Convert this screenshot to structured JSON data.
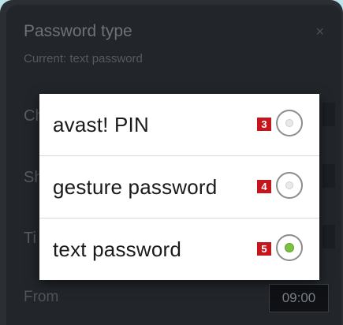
{
  "background_screen": {
    "title": "Password type",
    "subtitle": "Current: text password",
    "close_glyph": "×",
    "row_labels": [
      "Ch",
      "Sh",
      "Ti"
    ],
    "from_label": "From",
    "from_time": "09:00"
  },
  "dialog": {
    "options": [
      {
        "label": "avast! PIN",
        "badge": "3",
        "selected": false
      },
      {
        "label": "gesture password",
        "badge": "4",
        "selected": false
      },
      {
        "label": "text password",
        "badge": "5",
        "selected": true
      }
    ]
  },
  "colors": {
    "accent_selected": "#7bc043",
    "badge": "#c4161c"
  }
}
